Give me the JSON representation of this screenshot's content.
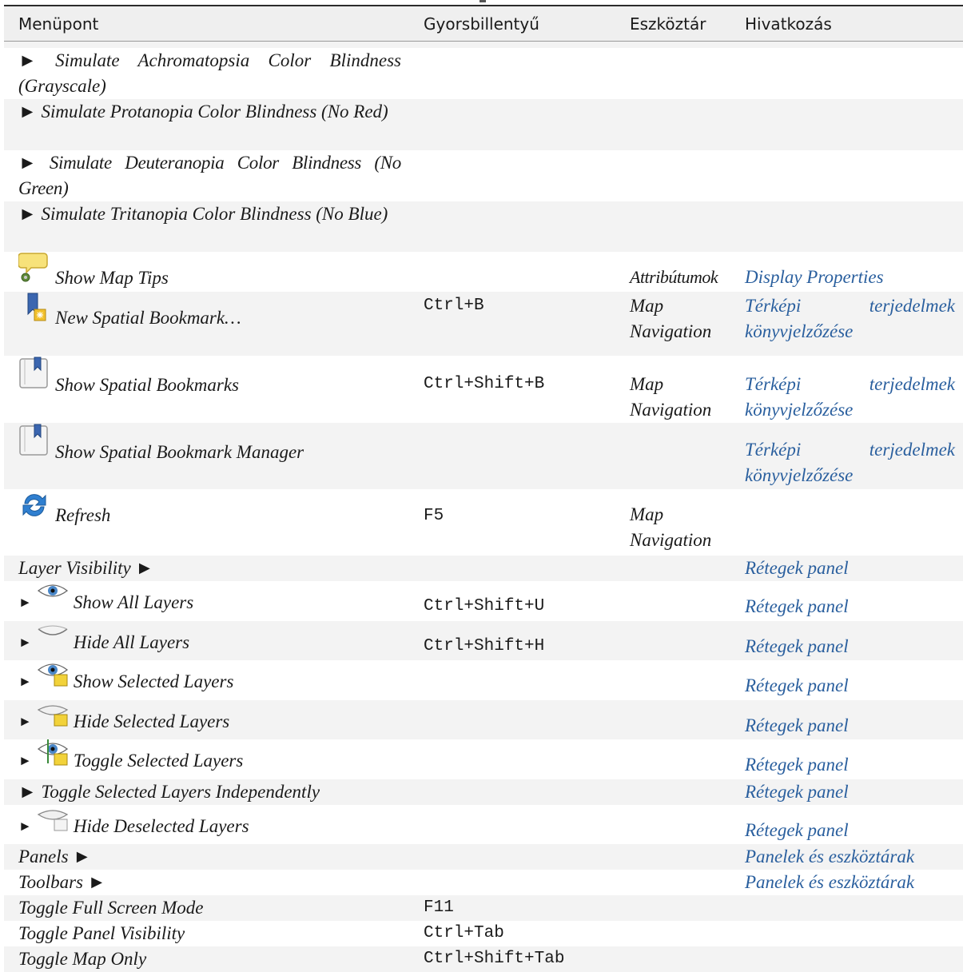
{
  "headers": [
    "Menüpont",
    "Gyorsbillentyű",
    "Eszköztár",
    "Hivatkozás"
  ],
  "rows": [
    {
      "label": "► Simulate Achromatopsia Color Blindness (Grayscale)",
      "shortcut": "",
      "toolbar": "",
      "link": ""
    },
    {
      "label": "► Simulate Protanopia Color Blindness (No Red)",
      "shortcut": "",
      "toolbar": "",
      "link": ""
    },
    {
      "label": "► Simulate Deuteranopia Color Blindness (No Green)",
      "shortcut": "",
      "toolbar": "",
      "link": ""
    },
    {
      "label": "► Simulate Tritanopia Color Blindness (No Blue)",
      "shortcut": "",
      "toolbar": "",
      "link": ""
    },
    {
      "label": "Show Map Tips",
      "shortcut": "",
      "toolbar": "Attribútumok",
      "link": "Display Properties",
      "icon": "map-tips-icon"
    },
    {
      "label": "New Spatial Bookmark…",
      "shortcut": "Ctrl+B",
      "toolbar": "Map Navigation",
      "link": "Térképi terjedelmek könyvjelzőzése",
      "icon": "new-bookmark-icon"
    },
    {
      "label": "Show Spatial Bookmarks",
      "shortcut": "Ctrl+Shift+B",
      "toolbar": "Map Navigation",
      "link": "Térképi terjedelmek könyvjelzőzése",
      "icon": "bookmarks-icon"
    },
    {
      "label": "Show Spatial Bookmark Manager",
      "shortcut": "",
      "toolbar": "",
      "link": "Térképi terjedelmek könyvjelzőzése",
      "icon": "bookmark-manager-icon"
    },
    {
      "label": "Refresh",
      "shortcut": "F5",
      "toolbar": "Map Navigation",
      "link": "",
      "icon": "refresh-icon"
    },
    {
      "label": "Layer Visibility ►",
      "shortcut": "",
      "toolbar": "",
      "link": "Rétegek panel"
    },
    {
      "label": "Show All Layers",
      "shortcut": "Ctrl+Shift+U",
      "toolbar": "",
      "link": "Rétegek panel",
      "icon": "eye-icon"
    },
    {
      "label": "Hide All Layers",
      "shortcut": "Ctrl+Shift+H",
      "toolbar": "",
      "link": "Rétegek panel",
      "icon": "eye-closed-icon"
    },
    {
      "label": "Show Selected Layers",
      "shortcut": "",
      "toolbar": "",
      "link": "Rétegek panel",
      "icon": "eye-selected-icon"
    },
    {
      "label": "Hide Selected Layers",
      "shortcut": "",
      "toolbar": "",
      "link": "Rétegek panel",
      "icon": "eye-closed-selected-icon"
    },
    {
      "label": "Toggle Selected Layers",
      "shortcut": "",
      "toolbar": "",
      "link": "Rétegek panel",
      "icon": "eye-toggle-icon"
    },
    {
      "label": "► Toggle Selected Layers Independently",
      "shortcut": "",
      "toolbar": "",
      "link": "Rétegek panel"
    },
    {
      "label": "Hide Deselected Layers",
      "shortcut": "",
      "toolbar": "",
      "link": "Rétegek panel",
      "icon": "eye-closed-deselected-icon"
    },
    {
      "label": "Panels ►",
      "shortcut": "",
      "toolbar": "",
      "link": "Panelek és eszköztárak"
    },
    {
      "label": "Toolbars ►",
      "shortcut": "",
      "toolbar": "",
      "link": "Panelek és eszköztárak"
    },
    {
      "label": "Toggle Full Screen Mode",
      "shortcut": "F11",
      "toolbar": "",
      "link": ""
    },
    {
      "label": "Toggle Panel Visibility",
      "shortcut": "Ctrl+Tab",
      "toolbar": "",
      "link": ""
    },
    {
      "label": "Toggle Map Only",
      "shortcut": "Ctrl+Shift+Tab",
      "toolbar": "",
      "link": ""
    }
  ],
  "arrow": "►",
  "colors": {
    "link": "#2a5f9e",
    "header_bg": "#efefef",
    "row_alt": "#f3f3f3"
  }
}
